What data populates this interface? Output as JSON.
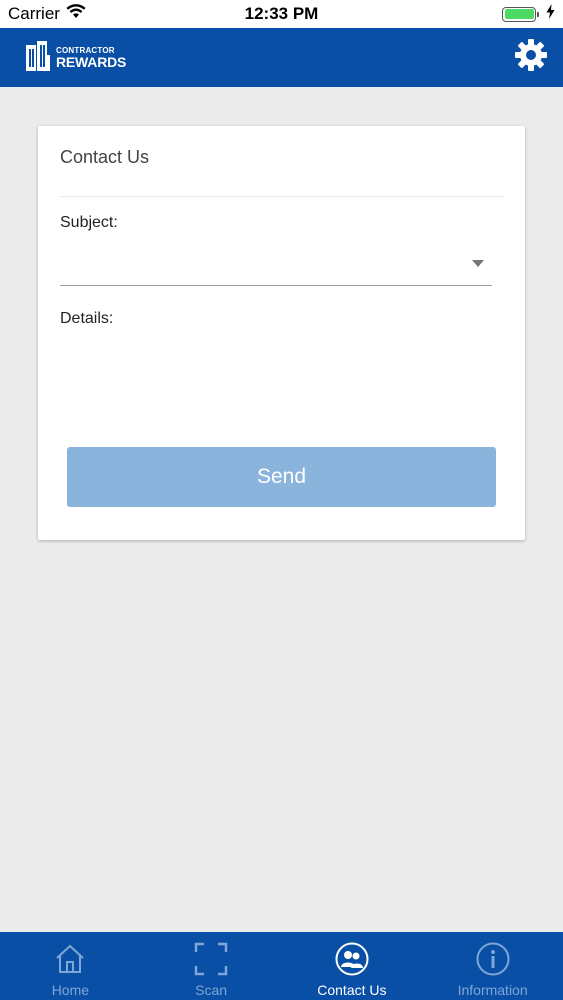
{
  "status_bar": {
    "carrier": "Carrier",
    "time": "12:33 PM",
    "battery_level": 1.0
  },
  "header": {
    "logo_small": "CONTRACTOR",
    "logo_big": "REWARDS",
    "settings_icon": "gear-icon"
  },
  "card": {
    "title": "Contact Us",
    "subject_label": "Subject:",
    "subject_value": "",
    "details_label": "Details:",
    "details_value": "",
    "send_label": "Send"
  },
  "tabs": [
    {
      "label": "Home",
      "icon": "home-icon",
      "active": false
    },
    {
      "label": "Scan",
      "icon": "scan-icon",
      "active": false
    },
    {
      "label": "Contact Us",
      "icon": "contact-icon",
      "active": true
    },
    {
      "label": "Information",
      "icon": "info-icon",
      "active": false
    }
  ],
  "colors": {
    "brand_blue": "#0a4fa6",
    "button_disabled": "#8ab4dc",
    "background": "#ebebeb",
    "battery_green": "#4cd964"
  }
}
